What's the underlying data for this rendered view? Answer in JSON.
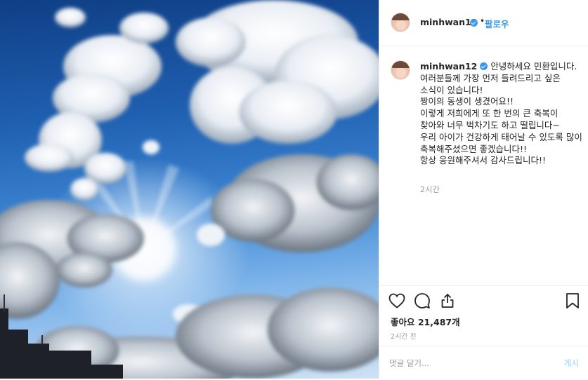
{
  "header": {
    "username": "minhwan12",
    "separator": "•",
    "follow_label": "팔로우"
  },
  "caption": {
    "username": "minhwan12",
    "text": "안녕하세요 민환입니다.\n여러분들께 가장 먼저 들려드리고 싶은 소식이 있습니다!\n짱이의 동생이 생겼어요!!\n이렇게 저희에게 또 한 번의 큰 축복이 찾아와 너무 벅차기도 하고 떨립니다~\n우리 아이가 건강하게 태어날 수 있도록 많이 축복해주셨으면 좋겠습니다!!\n항상 응원해주셔서 감사드립니다!!",
    "time_ago": "2시간"
  },
  "actions": {
    "icons": [
      "heart-icon",
      "comment-icon",
      "share-icon",
      "bookmark-icon"
    ],
    "likes_text": "좋아요 21,487개",
    "posted_ago": "2시간 전"
  },
  "comment": {
    "placeholder": "댓글 달기...",
    "post_label": "게시"
  },
  "colors": {
    "accent": "#3897f0",
    "post_disabled": "#b2dffc",
    "muted": "#999999",
    "border": "#efefef"
  }
}
